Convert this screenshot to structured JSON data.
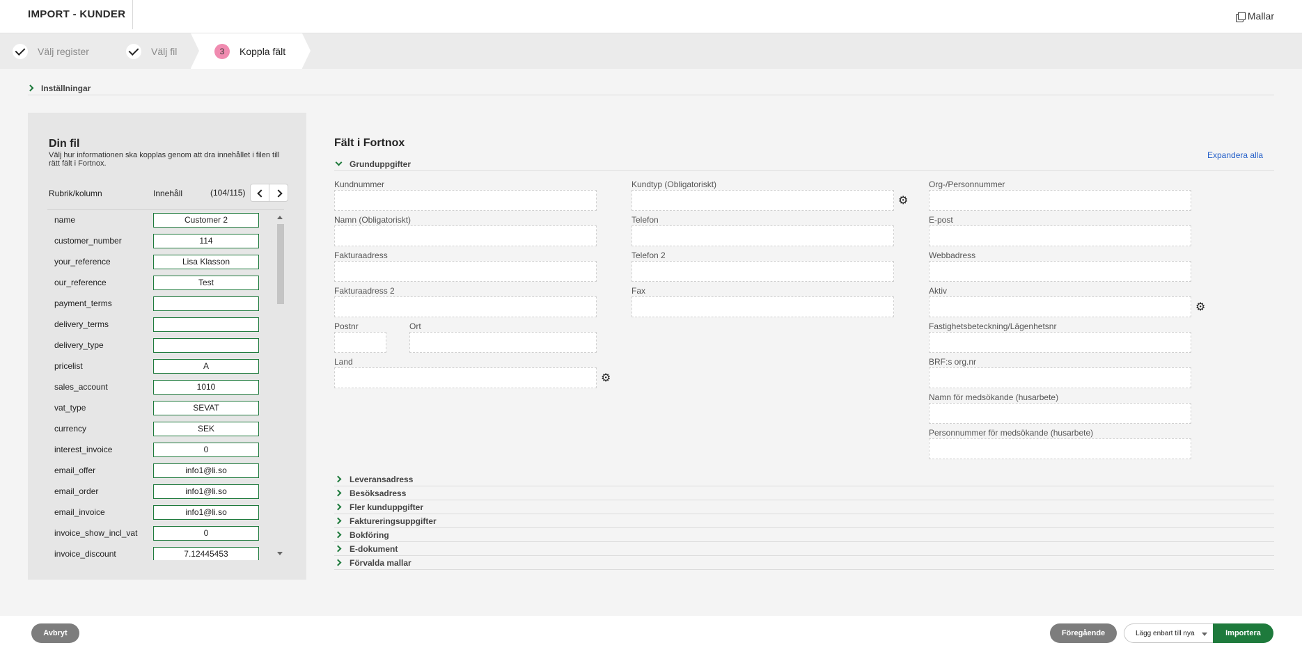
{
  "header": {
    "title": "IMPORT - KUNDER",
    "templates_label": "Mallar"
  },
  "stepper": {
    "steps": [
      {
        "label": "Välj register",
        "state": "done"
      },
      {
        "label": "Välj fil",
        "state": "done"
      },
      {
        "label": "Koppla fält",
        "number": "3",
        "state": "active"
      }
    ]
  },
  "settings": {
    "label": "Inställningar"
  },
  "file_panel": {
    "title": "Din fil",
    "description": "Välj hur informationen ska kopplas genom att dra innehållet i filen till rätt fält i Fortnox.",
    "col_rubrik": "Rubrik/kolumn",
    "col_innehall": "Innehåll",
    "paginator": "(104/115)",
    "rows": [
      {
        "key": "name",
        "value": "Customer 2"
      },
      {
        "key": "customer_number",
        "value": "114"
      },
      {
        "key": "your_reference",
        "value": "Lisa Klasson"
      },
      {
        "key": "our_reference",
        "value": "Test"
      },
      {
        "key": "payment_terms",
        "value": ""
      },
      {
        "key": "delivery_terms",
        "value": ""
      },
      {
        "key": "delivery_type",
        "value": ""
      },
      {
        "key": "pricelist",
        "value": "A"
      },
      {
        "key": "sales_account",
        "value": "1010"
      },
      {
        "key": "vat_type",
        "value": "SEVAT"
      },
      {
        "key": "currency",
        "value": "SEK"
      },
      {
        "key": "interest_invoice",
        "value": "0"
      },
      {
        "key": "email_offer",
        "value": "info1@li.so"
      },
      {
        "key": "email_order",
        "value": "info1@li.so"
      },
      {
        "key": "email_invoice",
        "value": "info1@li.so"
      },
      {
        "key": "invoice_show_incl_vat",
        "value": "0"
      },
      {
        "key": "invoice_discount",
        "value": "7.12445453"
      }
    ]
  },
  "fortnox": {
    "title": "Fält i Fortnox",
    "expand_all": "Expandera alla",
    "basic_section": "Grunduppgifter",
    "fields": {
      "kundnummer": "Kundnummer",
      "kundtyp": "Kundtyp (Obligatoriskt)",
      "orgnr": "Org-/Personnummer",
      "namn": "Namn (Obligatoriskt)",
      "telefon": "Telefon",
      "epost": "E-post",
      "fakturaadress": "Fakturaadress",
      "telefon2": "Telefon 2",
      "webbadress": "Webbadress",
      "fakturaadress2": "Fakturaadress 2",
      "fax": "Fax",
      "aktiv": "Aktiv",
      "postnr": "Postnr",
      "ort": "Ort",
      "fastighet": "Fastighetsbeteckning/Lägenhetsnr",
      "land": "Land",
      "brf": "BRF:s org.nr",
      "medsokande_namn": "Namn för medsökande (husarbete)",
      "medsokande_pnr": "Personnummer för medsökande (husarbete)"
    },
    "sections": [
      "Leveransadress",
      "Besöksadress",
      "Fler kunduppgifter",
      "Faktureringsuppgifter",
      "Bokföring",
      "E-dokument",
      "Förvalda mallar"
    ]
  },
  "footer": {
    "cancel": "Avbryt",
    "previous": "Föregående",
    "import_mode": "Lägg enbart till nya",
    "import": "Importera"
  },
  "colors": {
    "accent_green": "#1e7a3c",
    "step_active": "#f08bb0",
    "link_blue": "#2560c9"
  }
}
